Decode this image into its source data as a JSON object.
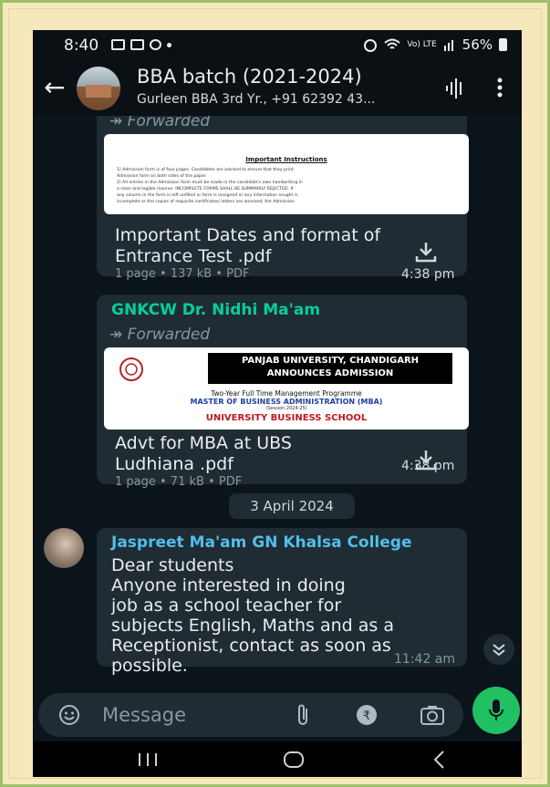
{
  "status_bar": {
    "time": "8:40",
    "network": "Vo) LTE",
    "battery": "56%"
  },
  "header": {
    "title": "BBA batch (2021-2024)",
    "subtitle": "Gurleen BBA 3rd Yr., +91 62392 43..."
  },
  "messages": [
    {
      "forwarded": "Forwarded",
      "thumb_heading": "Important Instructions",
      "thumb_lines": [
        "1)  Admission form is of four pages. Candidates are advised to ensure that they print",
        "     Admission form on both sides of the paper.",
        "2)  All entries in the Admission form must be made in the candidate's own handwriting in",
        "     a clear and legible manner. INCOMPLETE FORMS SHALL BE SUMMARILY REJECTED. If",
        "     any column in the form is left unfilled or form is unsigned or any information sought is",
        "     incomplete or the copies of requisite certificates/ letters are annexed, the Admission"
      ],
      "file_name": "Important Dates and format of Entrance Test .pdf",
      "file_meta": "1 page • 137 kB • PDF",
      "time": "4:38 pm"
    },
    {
      "sender": "GNKCW Dr. Nidhi Ma'am",
      "forwarded": "Forwarded",
      "thumb_banner_1": "PANJAB UNIVERSITY, CHANDIGARH",
      "thumb_banner_2": "ANNOUNCES ADMISSION",
      "thumb_line_1": "Two-Year Full Time Management Programme",
      "thumb_line_2": "MASTER OF BUSINESS ADMINISTRATION (MBA)",
      "thumb_line_3": "(Session 2024-25)",
      "thumb_line_4": "UNIVERSITY BUSINESS SCHOOL",
      "file_name": "Advt for MBA at UBS Ludhiana .pdf",
      "file_meta": "1 page • 71 kB • PDF",
      "time": "4:38 pm"
    },
    {
      "date_divider": "3 April 2024",
      "sender": "Jaspreet Ma'am GN Khalsa College",
      "text_lines": [
        "Dear students",
        "Anyone interested in doing",
        "job as a school teacher for",
        "subjects English, Maths and as a",
        "Receptionist, contact as soon  as",
        "possible."
      ],
      "time": "11:42 am"
    }
  ],
  "composer": {
    "placeholder": "Message"
  },
  "colors": {
    "bg": "#0b141a",
    "bubble": "#1f2c33",
    "sender_green": "#53bdeb",
    "sender_nidhi": "#06cf9c",
    "sender_jaspreet": "#53bdeb",
    "mic": "#21c063",
    "frame": "#f6e8bd"
  },
  "icons": [
    "back-arrow-icon",
    "voice-call-icon",
    "more-options-icon",
    "forward-icon",
    "download-icon",
    "chevron-down-icon",
    "emoji-icon",
    "attach-icon",
    "rupee-icon",
    "camera-icon",
    "mic-icon",
    "recent-apps-icon",
    "home-icon",
    "back-nav-icon"
  ]
}
